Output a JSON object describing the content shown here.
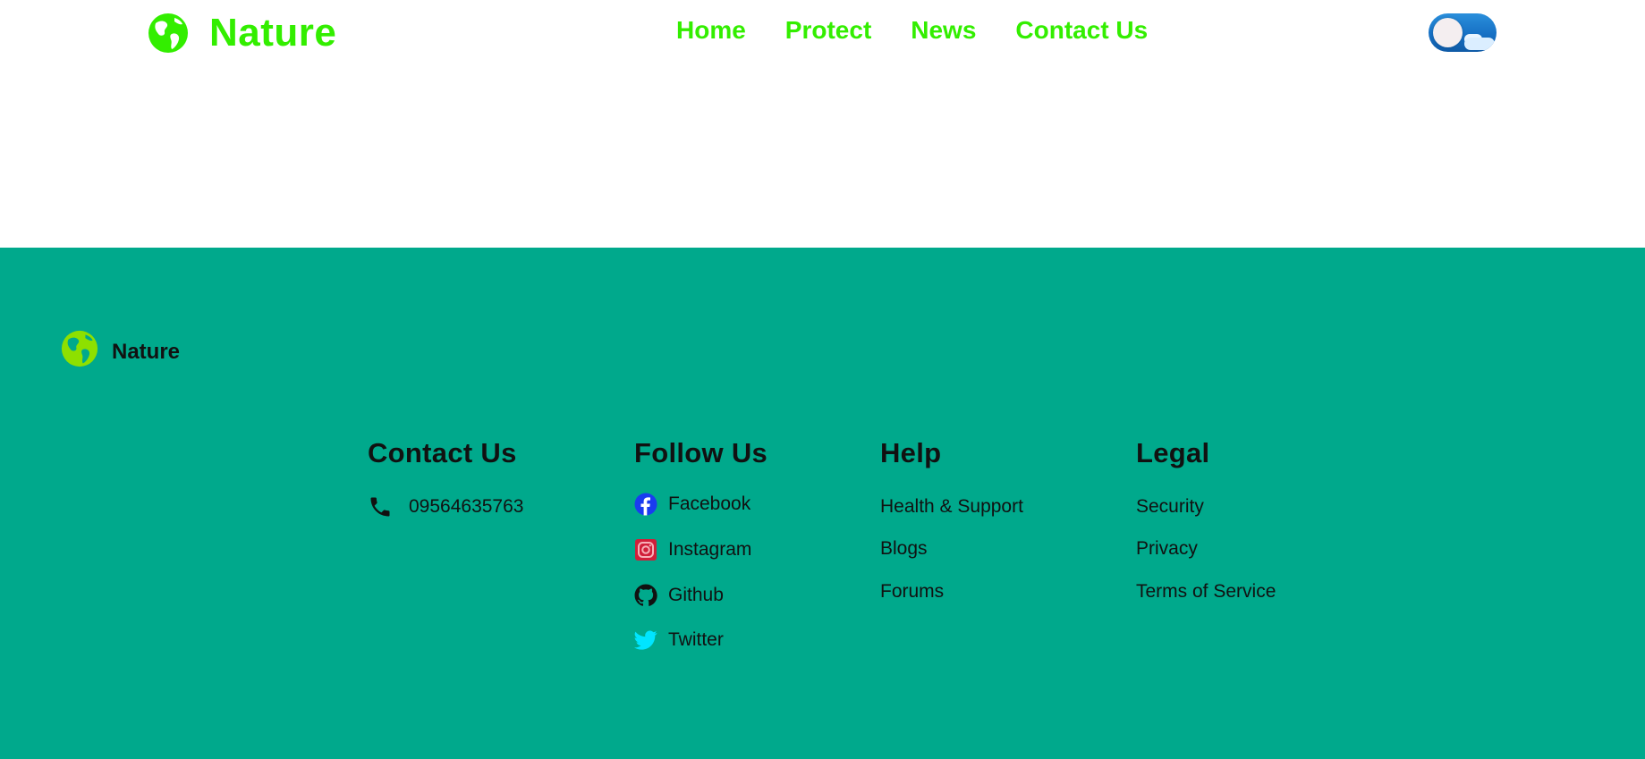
{
  "header": {
    "brand_name": "Nature",
    "nav": [
      "Home",
      "Protect",
      "News",
      "Contact Us"
    ],
    "theme_toggle_icon": "day-sky-toggle"
  },
  "footer": {
    "brand_name": "Nature",
    "contact": {
      "heading": "Contact Us",
      "phone": "09564635763"
    },
    "follow": {
      "heading": "Follow Us",
      "items": [
        "Facebook",
        "Instagram",
        "Github",
        "Twitter"
      ]
    },
    "help": {
      "heading": "Help",
      "items": [
        "Health & Support",
        "Blogs",
        "Forums"
      ]
    },
    "legal": {
      "heading": "Legal",
      "items": [
        "Security",
        "Privacy",
        "Terms of Service"
      ]
    }
  },
  "colors": {
    "brand_green": "#33ee00",
    "footer_bg": "#00a98c",
    "facebook": "#1a3cf0",
    "instagram": "#d11f3a",
    "twitter": "#00e5ff"
  }
}
